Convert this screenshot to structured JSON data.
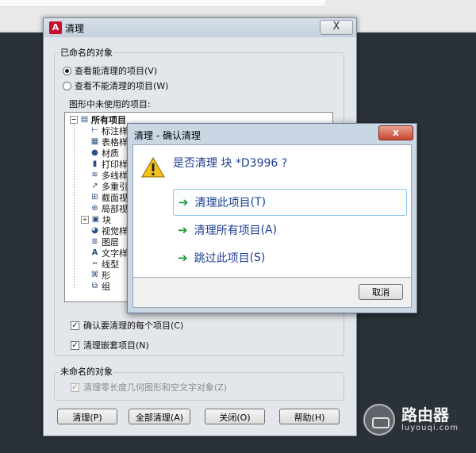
{
  "purge_dialog": {
    "title": "清理",
    "close_label": "X",
    "named_group_label": "已命名的对象",
    "radio_purgeable": "查看能清理的项目(V)",
    "radio_nonpurgeable": "查看不能清理的项目(W)",
    "tree_caption": "图形中未使用的项目:",
    "tree": {
      "root": "所有项目",
      "items": [
        "标注样式",
        "表格样式",
        "材质",
        "打印样式",
        "多线样式",
        "多重引线样式",
        "截面视图样式",
        "局部视图样式",
        "块",
        "视觉样式",
        "图层",
        "文字样式",
        "线型",
        "形",
        "组"
      ]
    },
    "check_confirm": "确认要清理的每个项目(C)",
    "check_nested": "清理嵌套项目(N)",
    "unnamed_group_label": "未命名的对象",
    "check_zero_length": "清理零长度几何图形和空文字对象(Z)",
    "buttons": {
      "purge": "清理(P)",
      "purge_all": "全部清理(A)",
      "close": "关闭(O)",
      "help": "帮助(H)"
    }
  },
  "confirm_dialog": {
    "title": "清理 - 确认清理",
    "close_label": "x",
    "question": "是否清理 块 *D3996 ?",
    "options": [
      {
        "label": "清理此项目",
        "hotkey": "(T)"
      },
      {
        "label": "清理所有项目",
        "hotkey": "(A)"
      },
      {
        "label": "跳过此项目",
        "hotkey": "(S)"
      }
    ],
    "cancel_label": "取消"
  },
  "watermark": {
    "cn": "路由器",
    "en": "luyouqi.com"
  },
  "colors": {
    "accent": "#1d3f91",
    "arrow": "#1c9c35",
    "close_red": "#c9452d"
  }
}
